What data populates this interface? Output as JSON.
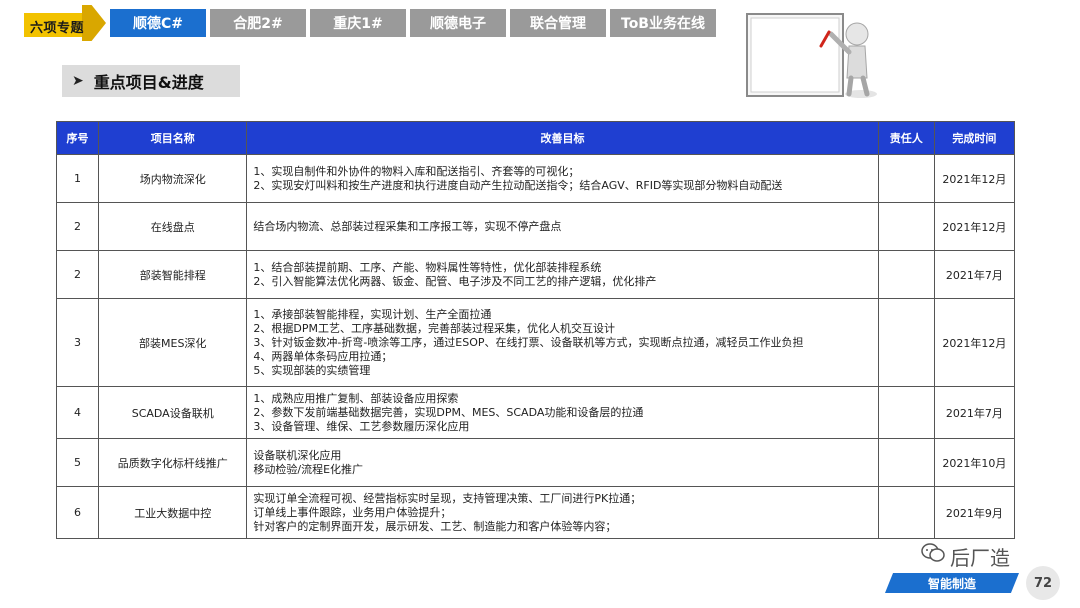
{
  "header": {
    "badge": "六项专题",
    "tabs": [
      {
        "label": "顺德C#",
        "active": true
      },
      {
        "label": "合肥2#"
      },
      {
        "label": "重庆1#"
      },
      {
        "label": "顺德电子"
      },
      {
        "label": "联合管理"
      },
      {
        "label": "ToB业务在线"
      }
    ]
  },
  "section": {
    "title": "重点项目&进度",
    "icon": "chevron-right-icon"
  },
  "table": {
    "headers": [
      "序号",
      "项目名称",
      "改善目标",
      "责任人",
      "完成时间"
    ],
    "rows": [
      {
        "no": "1",
        "name": "场内物流深化",
        "goals": [
          "1、实现自制件和外协件的物料入库和配送指引、齐套等的可视化；",
          "2、实现安灯叫料和按生产进度和执行进度自动产生拉动配送指令；结合AGV、RFID等实现部分物料自动配送"
        ],
        "owner": "",
        "date": "2021年12月"
      },
      {
        "no": "2",
        "name": "在线盘点",
        "goals": [
          "结合场内物流、总部装过程采集和工序报工等，实现不停产盘点"
        ],
        "owner": "",
        "date": "2021年12月"
      },
      {
        "no": "2",
        "name": "部装智能排程",
        "goals": [
          "1、结合部装提前期、工序、产能、物料属性等特性，优化部装排程系统",
          "2、引入智能算法优化两器、钣金、配管、电子涉及不同工艺的排产逻辑，优化排产"
        ],
        "owner": "",
        "date": "2021年7月"
      },
      {
        "no": "3",
        "name": "部装MES深化",
        "goals": [
          "1、承接部装智能排程，实现计划、生产全面拉通",
          "2、根据DPM工艺、工序基础数据，完善部装过程采集，优化人机交互设计",
          "3、针对钣金数冲-折弯-喷涂等工序，通过ESOP、在线打票、设备联机等方式，实现断点拉通，减轻员工作业负担",
          "4、两器单体条码应用拉通；",
          "5、实现部装的实绩管理"
        ],
        "owner": "",
        "date": "2021年12月"
      },
      {
        "no": "4",
        "name": "SCADA设备联机",
        "goals": [
          "1、成熟应用推广复制、部装设备应用探索",
          "2、参数下发前端基础数据完善，实现DPM、MES、SCADA功能和设备层的拉通",
          "3、设备管理、维保、工艺参数履历深化应用"
        ],
        "owner": "",
        "date": "2021年7月"
      },
      {
        "no": "5",
        "name": "品质数字化标杆线推广",
        "goals": [
          "设备联机深化应用",
          "移动检验/流程E化推广"
        ],
        "owner": "",
        "date": "2021年10月"
      },
      {
        "no": "6",
        "name": "工业大数据中控",
        "goals": [
          "实现订单全流程可视、经营指标实时呈现，支持管理决策、工厂间进行PK拉通；",
          "订单线上事件跟踪，业务用户体验提升；",
          "针对客户的定制界面开发，展示研发、工艺、制造能力和客户体验等内容；"
        ],
        "owner": "",
        "date": "2021年9月"
      }
    ]
  },
  "footer": {
    "brand": "后厂造",
    "label": "智能制造",
    "page": "72",
    "wechat_icon": "wechat-icon"
  },
  "colors": {
    "accent_blue": "#1b6fcf",
    "header_blue": "#1f3fd1",
    "badge_yellow": "#f2c200",
    "tab_gray": "#9a9a9a"
  }
}
